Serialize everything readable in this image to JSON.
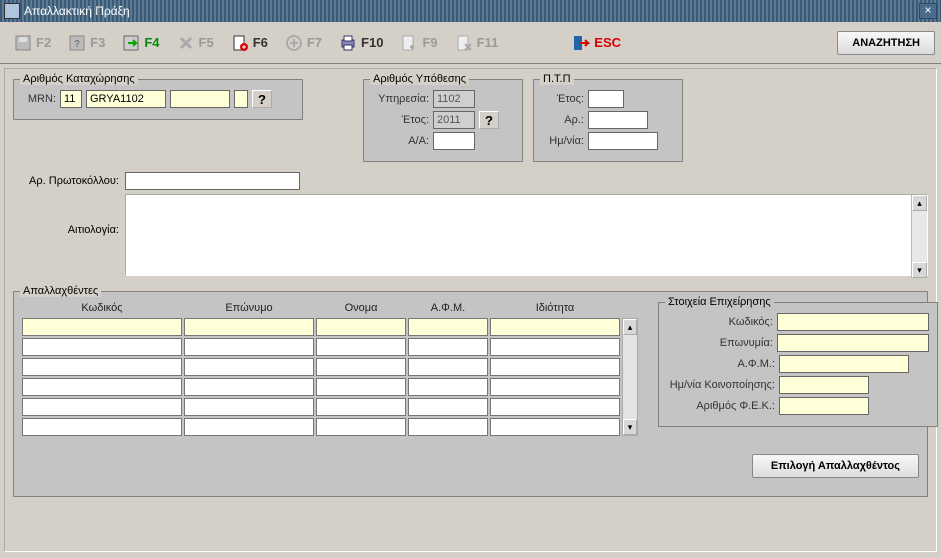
{
  "window": {
    "title": "Απαλλακτική Πράξη"
  },
  "toolbar": {
    "f2": "F2",
    "f3": "F3",
    "f4": "F4",
    "f5": "F5",
    "f6": "F6",
    "f7": "F7",
    "f10": "F10",
    "f9": "F9",
    "f11": "F11",
    "esc": "ESC",
    "search": "ΑΝΑΖΗΤΗΣΗ"
  },
  "mrn": {
    "legend": "Αριθμός Καταχώρησης",
    "label": "MRN:",
    "part1": "11",
    "part2": "GRYA1102",
    "part3": "",
    "part4": ""
  },
  "case": {
    "legend": "Αριθμός Υπόθεσης",
    "service_label": "Υπηρεσία:",
    "service": "1102",
    "year_label": "Έτος:",
    "year": "2011",
    "aa_label": "Α/Α:",
    "aa": ""
  },
  "ptp": {
    "legend": "Π.Τ.Π",
    "year_label": "Έτος:",
    "year": "",
    "ar_label": "Αρ.:",
    "ar": "",
    "date_label": "Ημ/νία:",
    "date": ""
  },
  "protocol": {
    "label": "Αρ. Πρωτοκόλλου:",
    "value": ""
  },
  "reason": {
    "label": "Αιτιολογία:",
    "value": ""
  },
  "list": {
    "legend": "Απαλλαχθέντες",
    "headers": {
      "code": "Κωδικός",
      "surname": "Επώνυμο",
      "name": "Ονομα",
      "afm": "Α.Φ.Μ.",
      "capacity": "Ιδιότητα"
    },
    "rows": [
      {
        "code": "",
        "surname": "",
        "name": "",
        "afm": "",
        "capacity": ""
      },
      {
        "code": "",
        "surname": "",
        "name": "",
        "afm": "",
        "capacity": ""
      },
      {
        "code": "",
        "surname": "",
        "name": "",
        "afm": "",
        "capacity": ""
      },
      {
        "code": "",
        "surname": "",
        "name": "",
        "afm": "",
        "capacity": ""
      },
      {
        "code": "",
        "surname": "",
        "name": "",
        "afm": "",
        "capacity": ""
      },
      {
        "code": "",
        "surname": "",
        "name": "",
        "afm": "",
        "capacity": ""
      }
    ],
    "select_btn": "Επιλογή Απαλλαχθέντος"
  },
  "business": {
    "legend": "Στοιχεία Επιχείρησης",
    "code_label": "Κωδικός:",
    "code": "",
    "name_label": "Επωνυμία:",
    "name": "",
    "afm_label": "Α.Φ.Μ.:",
    "afm": "",
    "notif_label": "Ημ/νία Κοινοποίησης:",
    "notif": "",
    "fek_label": "Αριθμός Φ.Ε.Κ.:",
    "fek": ""
  }
}
